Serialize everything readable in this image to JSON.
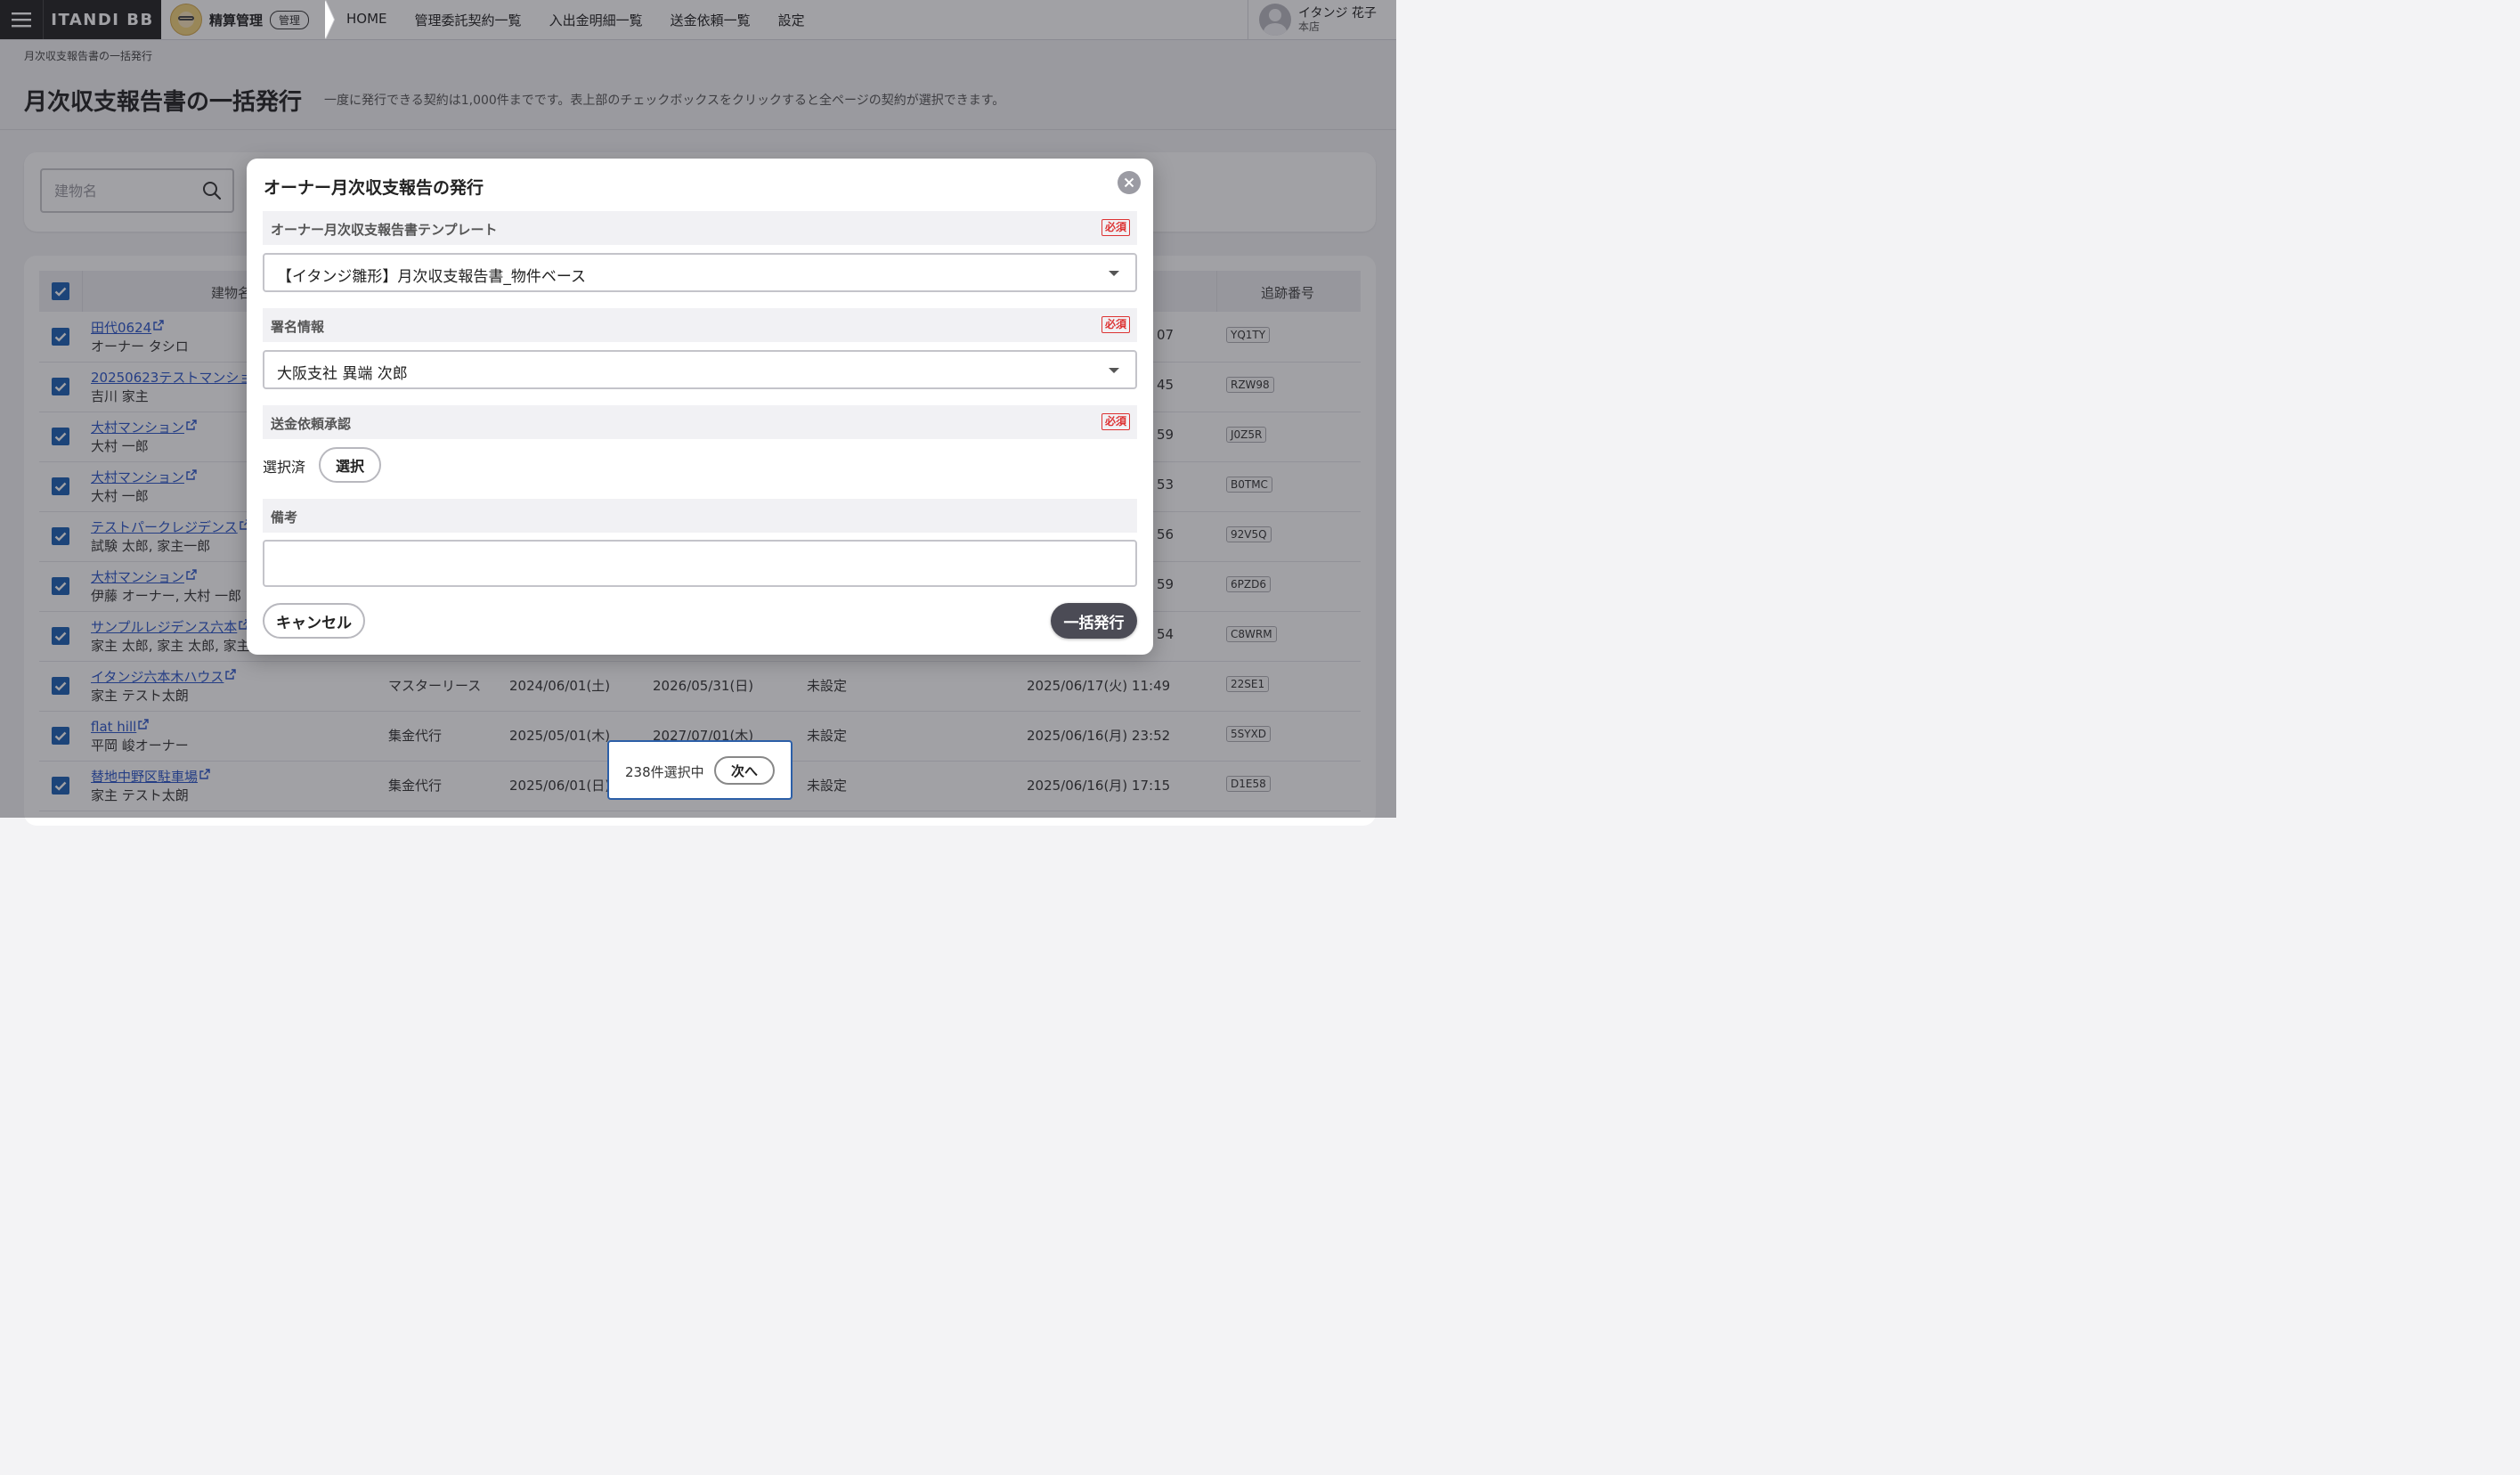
{
  "header": {
    "logo": "ITANDI BB",
    "app_name": "精算管理",
    "app_badge": "管理",
    "nav": [
      "HOME",
      "管理委託契約一覧",
      "入出金明細一覧",
      "送金依頼一覧",
      "設定"
    ],
    "user_name": "イタンジ 花子",
    "user_branch": "本店"
  },
  "breadcrumb": "月次収支報告書の一括発行",
  "page": {
    "title": "月次収支報告書の一括発行",
    "description": "一度に発行できる契約は1,000件までです。表上部のチェックボックスをクリックすると全ページの契約が選択できます。"
  },
  "search": {
    "placeholder": "建物名"
  },
  "table": {
    "col_name": "建物名",
    "col_tracking": "追跡番号",
    "rows": [
      {
        "name": "田代0624",
        "owner": "オーナー タシロ",
        "type": "",
        "start": "",
        "end": "",
        "status": "",
        "datetime": "07",
        "tracking": "YQ1TY"
      },
      {
        "name": "20250623テストマンショ",
        "owner": "吉川 家主",
        "type": "",
        "start": "",
        "end": "",
        "status": "",
        "datetime": "45",
        "tracking": "RZW98"
      },
      {
        "name": "大村マンション",
        "owner": "大村 一郎",
        "type": "",
        "start": "",
        "end": "",
        "status": "",
        "datetime": "59",
        "tracking": "J0Z5R"
      },
      {
        "name": "大村マンション",
        "owner": "大村 一郎",
        "type": "",
        "start": "",
        "end": "",
        "status": "",
        "datetime": "53",
        "tracking": "B0TMC"
      },
      {
        "name": "テストパークレジデンス",
        "owner": "試験 太郎, 家主一郎",
        "type": "",
        "start": "",
        "end": "",
        "status": "",
        "datetime": "56",
        "tracking": "92V5Q"
      },
      {
        "name": "大村マンション",
        "owner": "伊藤 オーナー, 大村 一郎",
        "type": "",
        "start": "",
        "end": "",
        "status": "",
        "datetime": "59",
        "tracking": "6PZD6"
      },
      {
        "name": "サンプルレジデンス六本",
        "owner": "家主 太郎, 家主 太郎, 家主",
        "type": "",
        "start": "",
        "end": "",
        "status": "",
        "datetime": "54",
        "tracking": "C8WRM"
      },
      {
        "name": "イタンジ六本木ハウス",
        "owner": "家主 テスト太朗",
        "type": "マスターリース",
        "start": "2024/06/01(土)",
        "end": "2026/05/31(日)",
        "status": "未設定",
        "datetime": "2025/06/17(火) 11:49",
        "tracking": "22SE1"
      },
      {
        "name": "flat hill",
        "owner": "平岡 峻オーナー",
        "type": "集金代行",
        "start": "2025/05/01(木)",
        "end": "2027/07/01(木)",
        "status": "未設定",
        "datetime": "2025/06/16(月) 23:52",
        "tracking": "5SYXD"
      },
      {
        "name": "替地中野区駐車場",
        "owner": "家主 テスト太朗",
        "type": "集金代行",
        "start": "2025/06/01(日)",
        "end": "",
        "status": "未設定",
        "datetime": "2025/06/16(月) 17:15",
        "tracking": "D1E58"
      }
    ]
  },
  "floating": {
    "count": "238件選択中",
    "next": "次へ"
  },
  "modal": {
    "title": "オーナー月次収支報告の発行",
    "required": "必須",
    "template_label": "オーナー月次収支報告書テンプレート",
    "template_value": "【イタンジ雛形】月次収支報告書_物件ベース",
    "signature_label": "署名情報",
    "signature_value": "大阪支社 異端 次郎",
    "approval_label": "送金依頼承認",
    "selected_text": "選択済",
    "choose_button": "選択",
    "remarks_label": "備考",
    "cancel": "キャンセル",
    "issue": "一括発行"
  },
  "colors": {
    "checkbox": "#1a5fb4",
    "link": "#2a55c9",
    "required": "#dd3333",
    "primary_button": "#4b4b55"
  }
}
